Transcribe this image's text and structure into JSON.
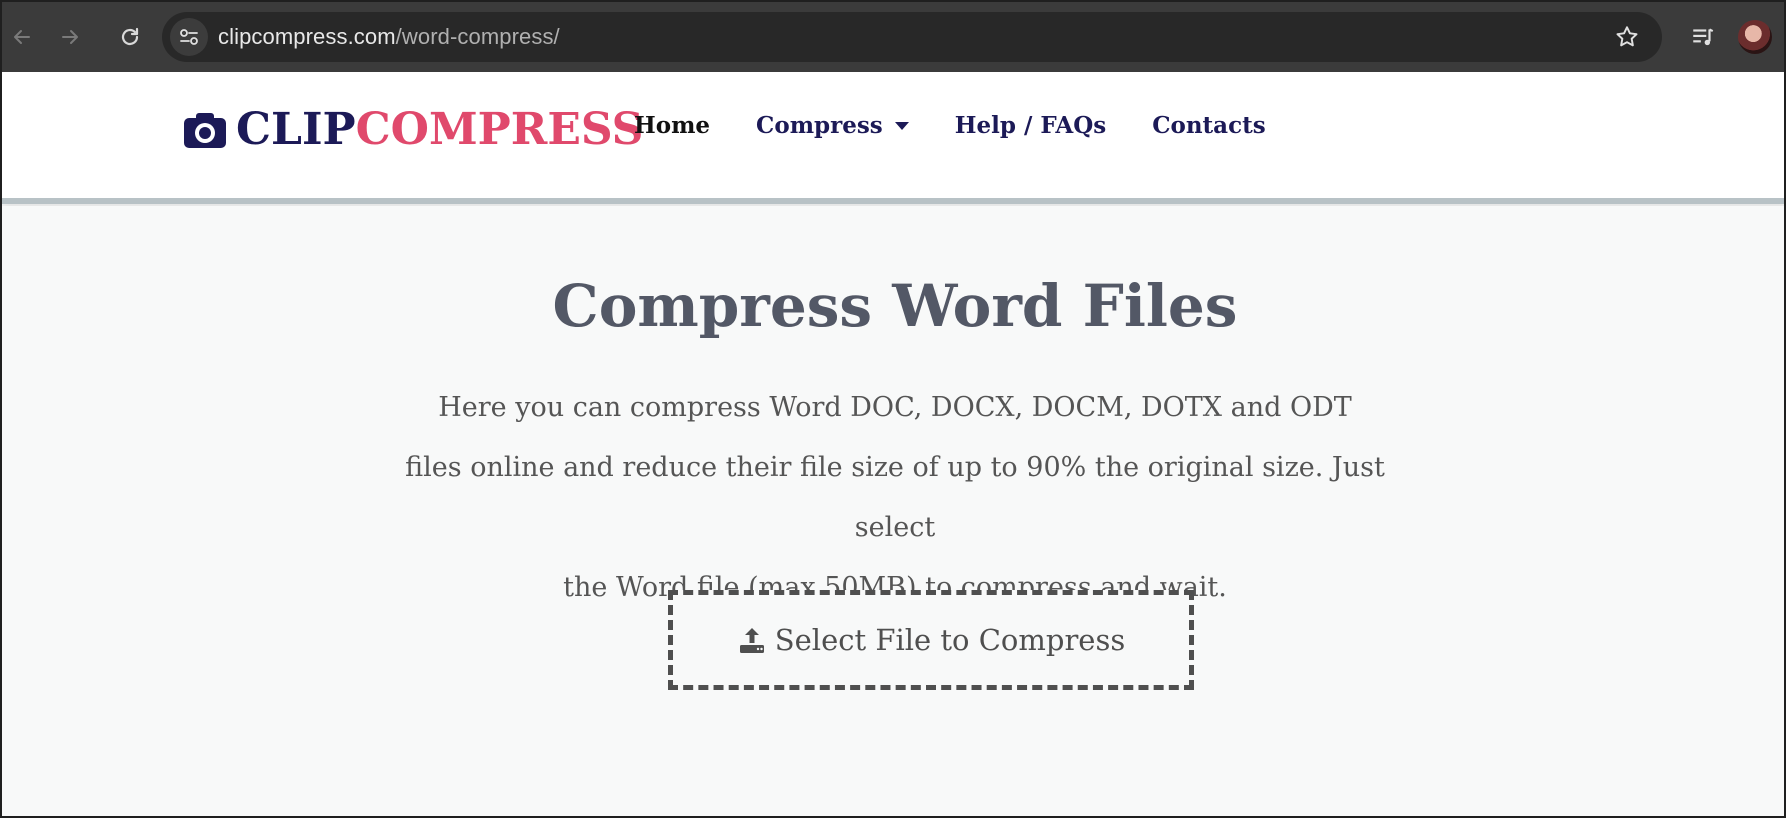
{
  "browser": {
    "url_domain": "clipcompress.com",
    "url_path": "/word-compress/"
  },
  "header": {
    "logo_part1": "CLIP",
    "logo_part2": "COMPRESS",
    "nav": {
      "home": "Home",
      "compress": "Compress",
      "help": "Help / FAQs",
      "contacts": "Contacts"
    }
  },
  "main": {
    "title": "Compress Word Files",
    "description_lines": [
      "Here you can compress Word DOC, DOCX, DOCM, DOTX and ODT",
      "files online and reduce their file size of up to 90% the original size. Just select",
      "the Word file (max 50MB) to compress and wait."
    ],
    "upload_label": "Select File to Compress"
  },
  "colors": {
    "brand_navy": "#1c1a57",
    "brand_pink": "#e0496c",
    "title_gray": "#535866"
  },
  "icons": [
    "back-arrow-icon",
    "forward-arrow-icon",
    "reload-icon",
    "site-info-icon",
    "star-icon",
    "media-queue-icon",
    "camera-icon",
    "upload-icon"
  ]
}
